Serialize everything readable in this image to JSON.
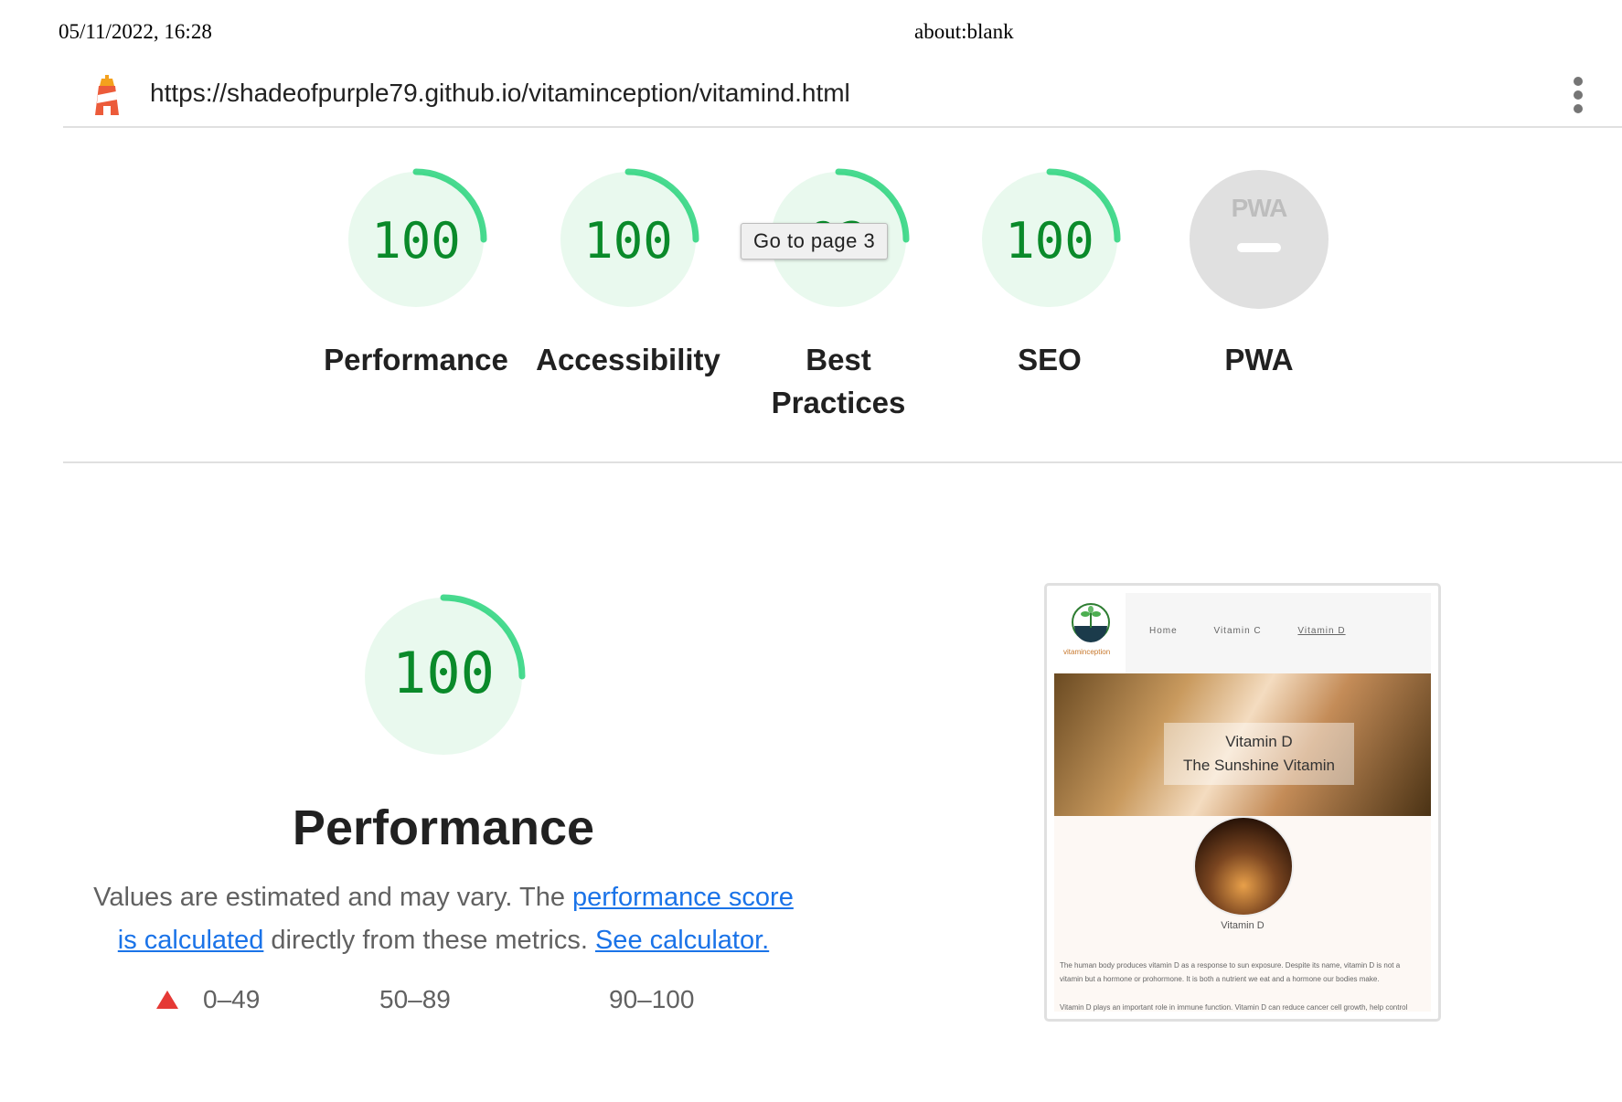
{
  "print_header": {
    "date": "05/11/2022, 16:28",
    "title": "about:blank"
  },
  "toolbar": {
    "url": "https://shadeofpurple79.github.io/vitaminception/vitamind.html"
  },
  "gauges": [
    {
      "score": "100",
      "label": "Performance"
    },
    {
      "score": "100",
      "label": "Accessibility"
    },
    {
      "score": "92",
      "label": "Best Practices"
    },
    {
      "score": "100",
      "label": "SEO"
    },
    {
      "score": "",
      "label": "PWA",
      "badge": "PWA"
    }
  ],
  "tooltip": "Go to page 3",
  "performance": {
    "score": "100",
    "title": "Performance",
    "desc_1": "Values are estimated and may vary. The ",
    "link_score": "performance score is calculated",
    "desc_2": " directly from these metrics. ",
    "link_calc": "See calculator."
  },
  "legend": [
    "0–49",
    "50–89",
    "90–100"
  ],
  "screenshot": {
    "nav": [
      "Home",
      "Vitamin C",
      "Vitamin D"
    ],
    "brand": "vitaminception",
    "hero_title": "Vitamin D",
    "hero_subtitle": "The Sunshine Vitamin",
    "caption": "Vitamin D",
    "paragraph_1": "The human body produces vitamin D as a response to sun exposure. Despite its name, vitamin D is not a vitamin but a hormone or prohormone. It is both a nutrient we eat and a hormone our bodies make.",
    "paragraph_2": "Vitamin D plays an important role in immune function. Vitamin D can reduce cancer cell growth, help control"
  },
  "colors": {
    "pass": "#0cce6b",
    "pass_text": "#0a8a2a",
    "pass_bg": "#e9f9ee",
    "link": "#1a73e8",
    "fail": "#e53935",
    "average": "#ffa400"
  },
  "icons": {
    "logo": "lighthouse-icon",
    "menu": "vertical-dots-icon"
  }
}
